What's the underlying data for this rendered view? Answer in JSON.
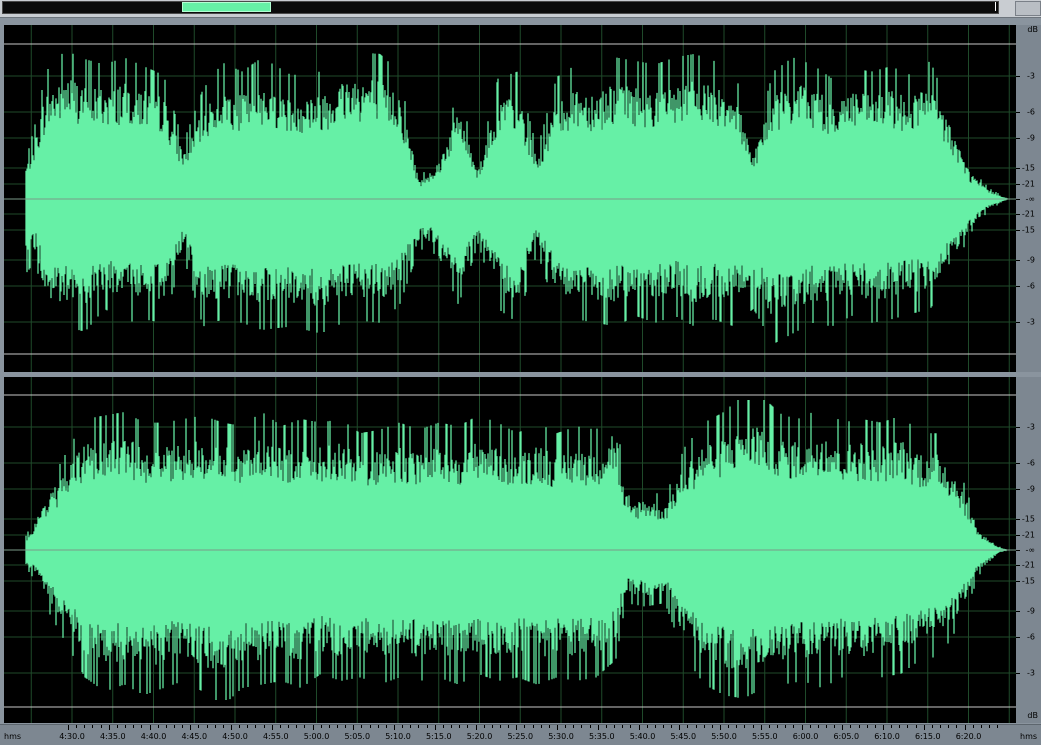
{
  "overview": {
    "view_start_fraction": 0.181,
    "view_end_fraction": 0.268
  },
  "time_ruler": {
    "unit_left": "hms",
    "unit_right": "hms",
    "ticks": [
      "4:30.0",
      "4:35.0",
      "4:40.0",
      "4:45.0",
      "4:50.0",
      "4:55.0",
      "5:00.0",
      "5:05.0",
      "5:10.0",
      "5:15.0",
      "5:20.0",
      "5:25.0",
      "5:30.0",
      "5:35.0",
      "5:40.0",
      "5:45.0",
      "5:50.0",
      "5:55.0",
      "6:00.0",
      "6:05.0",
      "6:10.0",
      "6:15.0",
      "6:20.0"
    ]
  },
  "db_ruler": {
    "unit": "dB",
    "upper": [
      "-3",
      "-6",
      "-9",
      "-15",
      "-21"
    ],
    "center": "-∞",
    "lower": [
      "-21",
      "-15",
      "-9",
      "-6",
      "-3"
    ]
  },
  "colors": {
    "waveform": "#66f0a6",
    "background": "#000000",
    "grid": "#1f4a2a",
    "centerline": "#7a9a88",
    "limit_line": "#c8c8c8"
  },
  "channels": [
    {
      "name": "left",
      "envelope_top": [
        [
          0,
          0.22
        ],
        [
          0.01,
          0.44
        ],
        [
          0.02,
          0.72
        ],
        [
          0.04,
          0.84
        ],
        [
          0.06,
          0.79
        ],
        [
          0.08,
          0.76
        ],
        [
          0.1,
          0.8
        ],
        [
          0.12,
          0.75
        ],
        [
          0.14,
          0.7
        ],
        [
          0.16,
          0.32
        ],
        [
          0.18,
          0.62
        ],
        [
          0.2,
          0.77
        ],
        [
          0.22,
          0.72
        ],
        [
          0.24,
          0.8
        ],
        [
          0.27,
          0.7
        ],
        [
          0.3,
          0.72
        ],
        [
          0.33,
          0.83
        ],
        [
          0.36,
          0.82
        ],
        [
          0.38,
          0.72
        ],
        [
          0.4,
          0.12
        ],
        [
          0.42,
          0.25
        ],
        [
          0.44,
          0.62
        ],
        [
          0.46,
          0.2
        ],
        [
          0.48,
          0.68
        ],
        [
          0.5,
          0.72
        ],
        [
          0.52,
          0.28
        ],
        [
          0.54,
          0.69
        ],
        [
          0.56,
          0.76
        ],
        [
          0.58,
          0.72
        ],
        [
          0.6,
          0.8
        ],
        [
          0.62,
          0.78
        ],
        [
          0.64,
          0.76
        ],
        [
          0.66,
          0.8
        ],
        [
          0.68,
          0.82
        ],
        [
          0.7,
          0.78
        ],
        [
          0.72,
          0.75
        ],
        [
          0.74,
          0.3
        ],
        [
          0.76,
          0.72
        ],
        [
          0.78,
          0.8
        ],
        [
          0.8,
          0.76
        ],
        [
          0.82,
          0.68
        ],
        [
          0.84,
          0.74
        ],
        [
          0.86,
          0.72
        ],
        [
          0.88,
          0.75
        ],
        [
          0.9,
          0.7
        ],
        [
          0.92,
          0.78
        ],
        [
          0.94,
          0.5
        ],
        [
          0.96,
          0.18
        ],
        [
          0.98,
          0.06
        ],
        [
          1,
          0.0
        ]
      ],
      "envelope_bottom": [
        [
          0,
          0.42
        ],
        [
          0.01,
          0.35
        ],
        [
          0.02,
          0.68
        ],
        [
          0.04,
          0.72
        ],
        [
          0.06,
          0.75
        ],
        [
          0.08,
          0.62
        ],
        [
          0.1,
          0.7
        ],
        [
          0.12,
          0.68
        ],
        [
          0.14,
          0.7
        ],
        [
          0.16,
          0.32
        ],
        [
          0.18,
          0.72
        ],
        [
          0.2,
          0.68
        ],
        [
          0.22,
          0.7
        ],
        [
          0.24,
          0.74
        ],
        [
          0.27,
          0.72
        ],
        [
          0.3,
          0.76
        ],
        [
          0.33,
          0.68
        ],
        [
          0.36,
          0.7
        ],
        [
          0.38,
          0.6
        ],
        [
          0.4,
          0.28
        ],
        [
          0.42,
          0.32
        ],
        [
          0.44,
          0.6
        ],
        [
          0.46,
          0.25
        ],
        [
          0.48,
          0.62
        ],
        [
          0.5,
          0.7
        ],
        [
          0.52,
          0.3
        ],
        [
          0.54,
          0.64
        ],
        [
          0.56,
          0.68
        ],
        [
          0.58,
          0.7
        ],
        [
          0.6,
          0.72
        ],
        [
          0.62,
          0.66
        ],
        [
          0.64,
          0.7
        ],
        [
          0.66,
          0.66
        ],
        [
          0.68,
          0.72
        ],
        [
          0.7,
          0.68
        ],
        [
          0.72,
          0.72
        ],
        [
          0.74,
          0.62
        ],
        [
          0.76,
          0.82
        ],
        [
          0.78,
          0.76
        ],
        [
          0.8,
          0.7
        ],
        [
          0.82,
          0.72
        ],
        [
          0.84,
          0.66
        ],
        [
          0.86,
          0.7
        ],
        [
          0.88,
          0.68
        ],
        [
          0.9,
          0.65
        ],
        [
          0.92,
          0.62
        ],
        [
          0.94,
          0.45
        ],
        [
          0.96,
          0.2
        ],
        [
          0.98,
          0.06
        ],
        [
          1,
          0.0
        ]
      ]
    },
    {
      "name": "right",
      "envelope_top": [
        [
          0,
          0.08
        ],
        [
          0.01,
          0.2
        ],
        [
          0.02,
          0.34
        ],
        [
          0.04,
          0.54
        ],
        [
          0.06,
          0.74
        ],
        [
          0.08,
          0.76
        ],
        [
          0.1,
          0.78
        ],
        [
          0.12,
          0.72
        ],
        [
          0.14,
          0.72
        ],
        [
          0.16,
          0.74
        ],
        [
          0.18,
          0.76
        ],
        [
          0.2,
          0.72
        ],
        [
          0.22,
          0.7
        ],
        [
          0.24,
          0.78
        ],
        [
          0.26,
          0.7
        ],
        [
          0.28,
          0.74
        ],
        [
          0.3,
          0.72
        ],
        [
          0.32,
          0.74
        ],
        [
          0.34,
          0.66
        ],
        [
          0.36,
          0.68
        ],
        [
          0.38,
          0.72
        ],
        [
          0.4,
          0.68
        ],
        [
          0.42,
          0.72
        ],
        [
          0.44,
          0.7
        ],
        [
          0.46,
          0.76
        ],
        [
          0.48,
          0.72
        ],
        [
          0.5,
          0.66
        ],
        [
          0.52,
          0.72
        ],
        [
          0.54,
          0.66
        ],
        [
          0.56,
          0.7
        ],
        [
          0.58,
          0.68
        ],
        [
          0.6,
          0.82
        ],
        [
          0.61,
          0.3
        ],
        [
          0.63,
          0.35
        ],
        [
          0.65,
          0.3
        ],
        [
          0.67,
          0.58
        ],
        [
          0.69,
          0.72
        ],
        [
          0.71,
          0.78
        ],
        [
          0.73,
          0.88
        ],
        [
          0.75,
          0.86
        ],
        [
          0.77,
          0.76
        ],
        [
          0.79,
          0.74
        ],
        [
          0.81,
          0.82
        ],
        [
          0.83,
          0.72
        ],
        [
          0.85,
          0.74
        ],
        [
          0.87,
          0.72
        ],
        [
          0.89,
          0.76
        ],
        [
          0.91,
          0.66
        ],
        [
          0.93,
          0.66
        ],
        [
          0.95,
          0.45
        ],
        [
          0.97,
          0.12
        ],
        [
          0.99,
          0.02
        ],
        [
          1,
          0.0
        ]
      ],
      "envelope_bottom": [
        [
          0,
          0.1
        ],
        [
          0.01,
          0.18
        ],
        [
          0.02,
          0.32
        ],
        [
          0.04,
          0.52
        ],
        [
          0.06,
          0.72
        ],
        [
          0.08,
          0.8
        ],
        [
          0.1,
          0.76
        ],
        [
          0.12,
          0.82
        ],
        [
          0.14,
          0.78
        ],
        [
          0.16,
          0.74
        ],
        [
          0.18,
          0.8
        ],
        [
          0.2,
          0.88
        ],
        [
          0.22,
          0.78
        ],
        [
          0.24,
          0.76
        ],
        [
          0.26,
          0.74
        ],
        [
          0.28,
          0.78
        ],
        [
          0.3,
          0.7
        ],
        [
          0.32,
          0.74
        ],
        [
          0.34,
          0.72
        ],
        [
          0.36,
          0.76
        ],
        [
          0.38,
          0.72
        ],
        [
          0.4,
          0.74
        ],
        [
          0.42,
          0.72
        ],
        [
          0.44,
          0.76
        ],
        [
          0.46,
          0.7
        ],
        [
          0.48,
          0.74
        ],
        [
          0.5,
          0.72
        ],
        [
          0.52,
          0.76
        ],
        [
          0.54,
          0.72
        ],
        [
          0.56,
          0.74
        ],
        [
          0.58,
          0.72
        ],
        [
          0.6,
          0.62
        ],
        [
          0.61,
          0.3
        ],
        [
          0.63,
          0.32
        ],
        [
          0.65,
          0.3
        ],
        [
          0.67,
          0.6
        ],
        [
          0.69,
          0.76
        ],
        [
          0.71,
          0.82
        ],
        [
          0.73,
          0.84
        ],
        [
          0.75,
          0.78
        ],
        [
          0.77,
          0.76
        ],
        [
          0.79,
          0.74
        ],
        [
          0.81,
          0.78
        ],
        [
          0.83,
          0.72
        ],
        [
          0.85,
          0.74
        ],
        [
          0.87,
          0.72
        ],
        [
          0.89,
          0.7
        ],
        [
          0.91,
          0.62
        ],
        [
          0.93,
          0.6
        ],
        [
          0.95,
          0.42
        ],
        [
          0.97,
          0.14
        ],
        [
          0.99,
          0.02
        ],
        [
          1,
          0.0
        ]
      ]
    }
  ]
}
